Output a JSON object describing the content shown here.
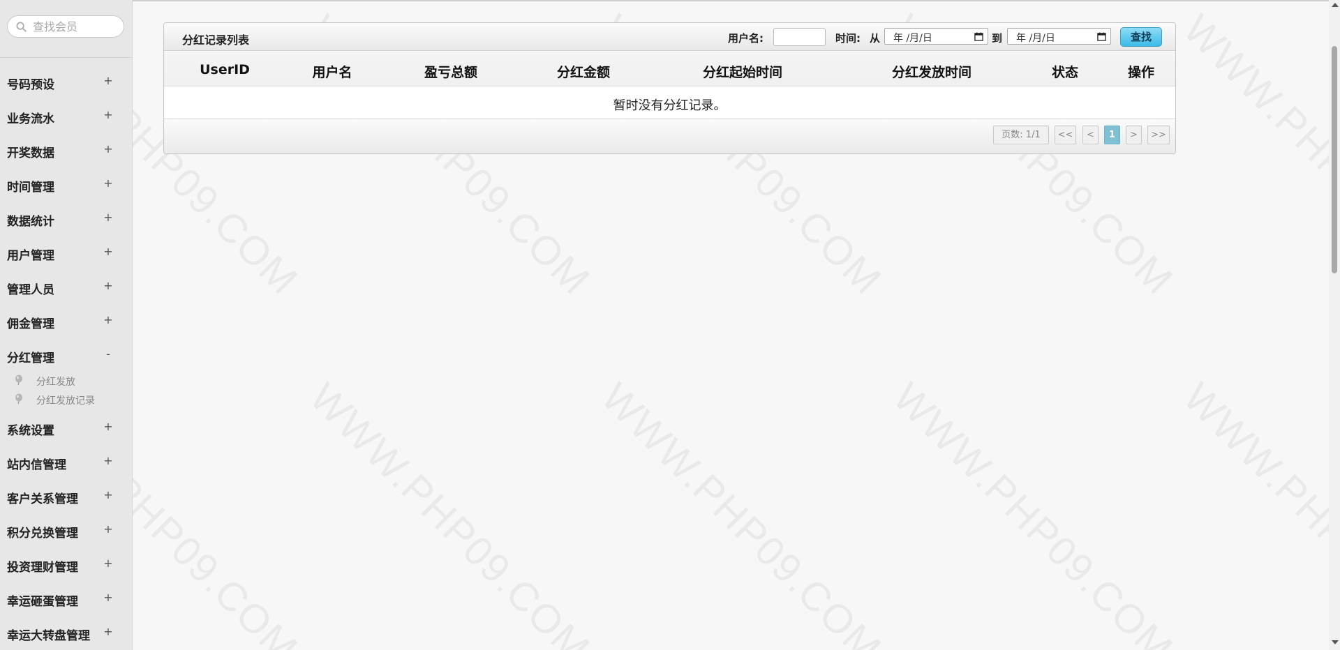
{
  "sidebar": {
    "search_placeholder": "查找会员",
    "items": [
      {
        "label": "号码预设",
        "toggle": "+"
      },
      {
        "label": "业务流水",
        "toggle": "+"
      },
      {
        "label": "开奖数据",
        "toggle": "+"
      },
      {
        "label": "时间管理",
        "toggle": "+"
      },
      {
        "label": "数据统计",
        "toggle": "+"
      },
      {
        "label": "用户管理",
        "toggle": "+"
      },
      {
        "label": "管理人员",
        "toggle": "+"
      },
      {
        "label": "佣金管理",
        "toggle": "+"
      },
      {
        "label": "分红管理",
        "toggle": "-"
      },
      {
        "label": "系统设置",
        "toggle": "+"
      },
      {
        "label": "站内信管理",
        "toggle": "+"
      },
      {
        "label": "客户关系管理",
        "toggle": "+"
      },
      {
        "label": "积分兑换管理",
        "toggle": "+"
      },
      {
        "label": "投资理财管理",
        "toggle": "+"
      },
      {
        "label": "幸运砸蛋管理",
        "toggle": "+"
      },
      {
        "label": "幸运大转盘管理",
        "toggle": "+"
      }
    ],
    "sub_items": [
      {
        "label": "分红发放"
      },
      {
        "label": "分红发放记录"
      }
    ]
  },
  "panel": {
    "title": "分红记录列表",
    "filter": {
      "username_label": "用户名:",
      "time_label": "时间:",
      "from_label": "从",
      "to_label": "到",
      "date_from": "年 /月/日",
      "date_to": "年 /月/日",
      "search_label": "查找"
    },
    "columns": [
      "UserID",
      "用户名",
      "盈亏总额",
      "分红金额",
      "分红起始时间",
      "分红发放时间",
      "状态",
      "操作"
    ],
    "empty_message": "暂时没有分红记录。",
    "pager": {
      "info": "页数: 1/1",
      "first": "<<",
      "prev": "<",
      "current": "1",
      "next": ">",
      "last": ">>"
    }
  },
  "watermark": "WWW.PHP09.COM",
  "colors": {
    "accent": "#3bbbe8",
    "current_page": "#7fc0d3",
    "sidebar_bg": "#e7e7e7"
  }
}
